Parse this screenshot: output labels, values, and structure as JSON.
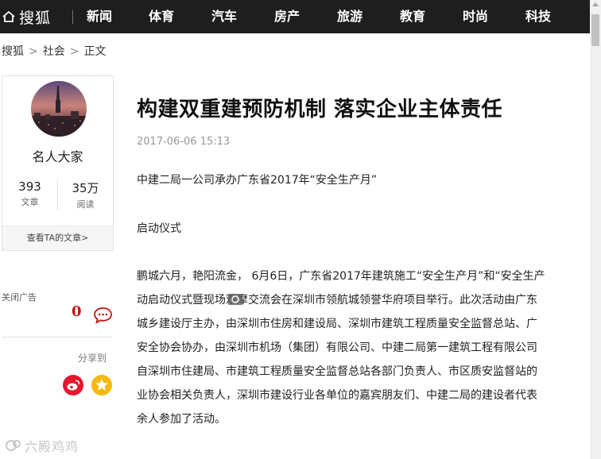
{
  "header": {
    "logo_text": "搜狐",
    "nav": [
      "新闻",
      "体育",
      "汽车",
      "房产",
      "旅游",
      "教育",
      "时尚",
      "科技"
    ]
  },
  "breadcrumb": [
    "搜狐",
    "社会",
    "正文"
  ],
  "author": {
    "name": "名人大家",
    "articles_count": "393",
    "articles_label": "文章",
    "reads_count": "35万",
    "reads_label": "阅读",
    "see_articles": "查看TA的文章>"
  },
  "sidebar": {
    "close_ad": "关闭广告",
    "comment_count": "0",
    "share_label": "分享到"
  },
  "article": {
    "title": "构建双重建预防机制 落实企业主体责任",
    "date": "2017-06-06 15:13",
    "subtitle": "中建二局一公司承办广东省2017年“安全生产月”",
    "section": "启动仪式",
    "body_lines": [
      "鹏城六月，艳阳流金， 6月6日，广东省2017年建筑施工“安全生产月”和“安全生产",
      "动启动仪式暨现场观摩交流会在深圳市领航城领誉华府项目举行。此次活动由广东",
      "城乡建设厅主办，由深圳市住房和建设局、深圳市建筑工程质量安全监督总站、广",
      "安全协会协办，由深圳市机场（集团）有限公司、中建二局第一建筑工程有限公司",
      "自深圳市住建局、市建筑工程质量安全监督总站各部门负责人、市区质安监督站的",
      "业协会相关负责人，深圳市建设行业各单位的嘉宾朋友们、中建二局的建设者代表",
      "余人参加了活动。"
    ]
  },
  "watermark": "六殿鸡鸡",
  "colors": {
    "nav_bg": "#1e1e1e",
    "comment_red": "#c21414",
    "weibo": "#e6162d",
    "qzone": "#f5b90e"
  }
}
